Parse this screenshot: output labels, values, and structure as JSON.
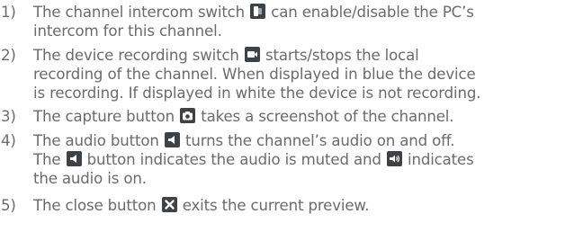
{
  "items": [
    {
      "number": "1)",
      "before": "The channel intercom switch",
      "icon": "intercom-switch-icon",
      "after": "can enable/disable the PC’s",
      "line2": "intercom for this channel."
    },
    {
      "number": "2)",
      "before": "The device recording switch",
      "icon": "device-recording-icon",
      "after": "starts/stops the local",
      "line2": "recording of the channel. When displayed in blue the device",
      "line3": "is recording. If displayed in white the device is not recording."
    },
    {
      "number": "3)",
      "before": "The capture button",
      "icon": "capture-camera-icon",
      "after": "takes a screenshot of the channel."
    },
    {
      "number": "4)",
      "before": "The audio button",
      "icon": "audio-button-icon",
      "after": "turns the channel’s audio on and off.",
      "line2_before": "The",
      "line2_icon": "audio-muted-icon",
      "line2_mid": "button indicates the audio is muted and",
      "line2_icon2": "audio-on-icon",
      "line2_after": "indicates",
      "line3": "the audio is on."
    },
    {
      "number": "5)",
      "before": "The close button",
      "icon": "close-x-icon",
      "after": "exits the current preview."
    }
  ],
  "colors": {
    "text": "#6b6b6b",
    "icon_background": "#3e4246",
    "icon_foreground": "#ffffff"
  }
}
